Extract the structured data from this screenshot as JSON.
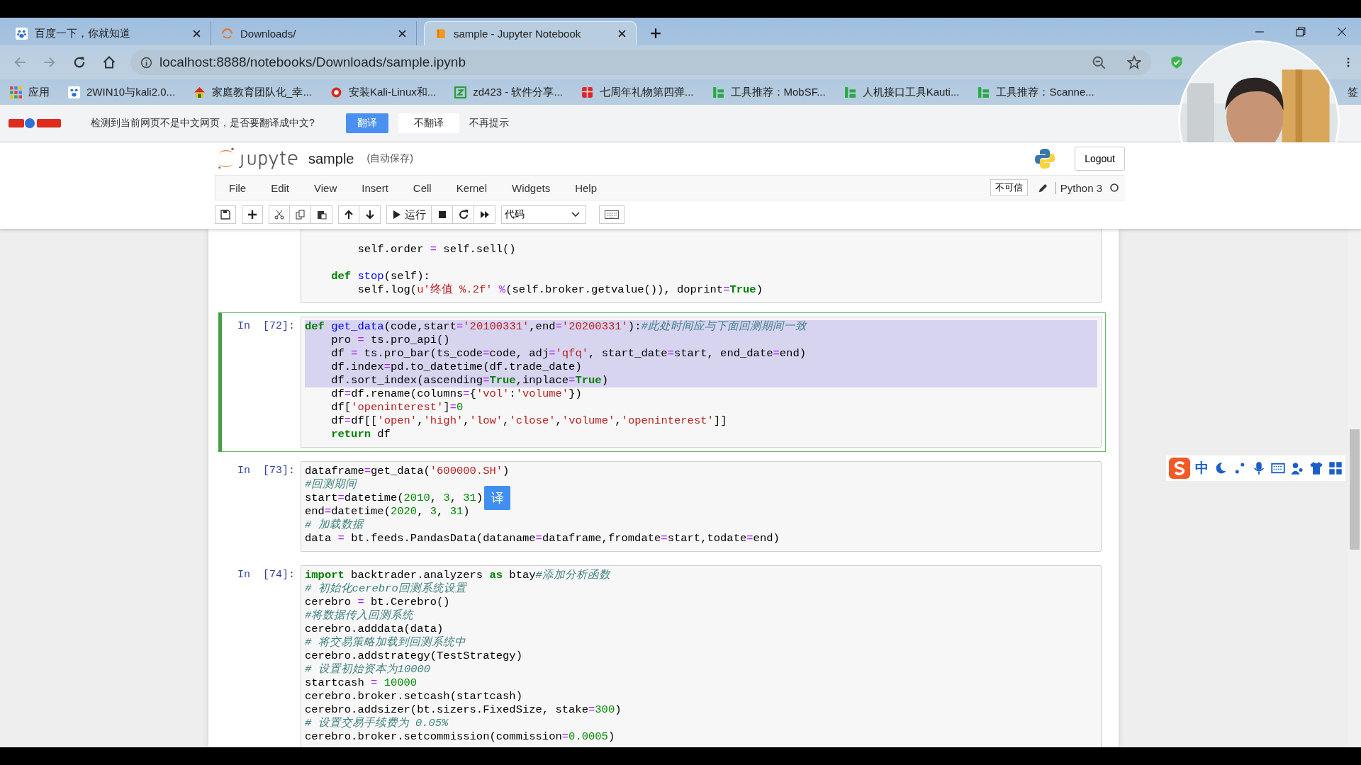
{
  "browser": {
    "tabs": [
      {
        "title": "百度一下，你就知道",
        "kind": "paw",
        "selected": false
      },
      {
        "title": "Downloads/",
        "kind": "spinner",
        "selected": false
      },
      {
        "title": "sample - Jupyter Notebook",
        "kind": "book",
        "selected": true
      }
    ],
    "address": "localhost:8888/notebooks/Downloads/sample.ipynb",
    "bookmarks": [
      {
        "label": "应用",
        "kind": "apps"
      },
      {
        "label": "2WIN10与kali2.0...",
        "kind": "paw"
      },
      {
        "label": "家庭教育团队化_幸...",
        "kind": "house"
      },
      {
        "label": "安装Kali-Linux和...",
        "kind": "red"
      },
      {
        "label": "zd423 - 软件分享...",
        "kind": "z"
      },
      {
        "label": "七周年礼物第四弹...",
        "kind": "gift"
      },
      {
        "label": "工具推荐：MobSF...",
        "kind": "bars"
      },
      {
        "label": "人机接口工具Kauti...",
        "kind": "bars"
      },
      {
        "label": "工具推荐：Scanne...",
        "kind": "bars"
      },
      {
        "label": "签",
        "kind": "folder"
      }
    ]
  },
  "translate_bar": {
    "message": "检测到当前网页不是中文网页，是否要翻译成中文?",
    "translate": "翻译",
    "dont": "不翻译",
    "never": "不再提示"
  },
  "notebook": {
    "name": "sample",
    "autosave": "(自动保存)",
    "logout": "Logout",
    "menu": [
      "File",
      "Edit",
      "View",
      "Insert",
      "Cell",
      "Kernel",
      "Widgets",
      "Help"
    ],
    "trust": "不可信",
    "kernel": "Python 3",
    "run_label": "运行",
    "cell_type": "代码",
    "cells": [
      {
        "selected": false,
        "lines": [
          {
            "highlighted": false,
            "tokens": [
              {
                "kind": "txt",
                "text": "        self.order "
              },
              {
                "kind": "op",
                "text": "="
              },
              {
                "kind": "txt",
                "text": " self.sell()"
              }
            ]
          },
          {
            "highlighted": false
          },
          {
            "highlighted": false,
            "tokens": [
              {
                "kind": "kw",
                "text": "    def "
              },
              {
                "kind": "fn",
                "text": "stop"
              },
              {
                "kind": "txt",
                "text": "(self):"
              }
            ]
          },
          {
            "highlighted": false,
            "tokens": [
              {
                "kind": "txt",
                "text": "        self.log("
              },
              {
                "kind": "str",
                "text": "u'终值 %.2f' "
              },
              {
                "kind": "op",
                "text": "%"
              },
              {
                "kind": "txt",
                "text": "(self.broker.getvalue()), doprint"
              },
              {
                "kind": "op",
                "text": "="
              },
              {
                "kind": "kw",
                "text": "True"
              },
              {
                "kind": "txt",
                "text": ")"
              }
            ]
          }
        ]
      },
      {
        "prompt": "In  [72]:",
        "selected": true,
        "lines": [
          {
            "highlighted": true,
            "tokens": [
              {
                "kind": "kw",
                "text": "def "
              },
              {
                "kind": "fn",
                "text": "get_data"
              },
              {
                "kind": "txt",
                "text": "(code,start"
              },
              {
                "kind": "op",
                "text": "="
              },
              {
                "kind": "str",
                "text": "'20100331'"
              },
              {
                "kind": "txt",
                "text": ",end"
              },
              {
                "kind": "op",
                "text": "="
              },
              {
                "kind": "str",
                "text": "'20200331'"
              },
              {
                "kind": "txt",
                "text": "):"
              },
              {
                "kind": "com",
                "text": "#此处时间应与下面回测期间一致"
              }
            ]
          },
          {
            "highlighted": true,
            "tokens": [
              {
                "kind": "txt",
                "text": "    pro "
              },
              {
                "kind": "op",
                "text": "="
              },
              {
                "kind": "txt",
                "text": " ts.pro_api()"
              }
            ]
          },
          {
            "highlighted": true,
            "tokens": [
              {
                "kind": "txt",
                "text": "    df "
              },
              {
                "kind": "op",
                "text": "="
              },
              {
                "kind": "txt",
                "text": " ts.pro_bar(ts_code"
              },
              {
                "kind": "op",
                "text": "="
              },
              {
                "kind": "txt",
                "text": "code, adj"
              },
              {
                "kind": "op",
                "text": "="
              },
              {
                "kind": "str",
                "text": "'qfq'"
              },
              {
                "kind": "txt",
                "text": ", start_date"
              },
              {
                "kind": "op",
                "text": "="
              },
              {
                "kind": "txt",
                "text": "start, end_date"
              },
              {
                "kind": "op",
                "text": "="
              },
              {
                "kind": "txt",
                "text": "end)"
              }
            ]
          },
          {
            "highlighted": true,
            "tokens": [
              {
                "kind": "txt",
                "text": "    df.index"
              },
              {
                "kind": "op",
                "text": "="
              },
              {
                "kind": "txt",
                "text": "pd.to_datetime(df.trade_date)"
              }
            ]
          },
          {
            "highlighted": true,
            "tokens": [
              {
                "kind": "txt",
                "text": "    df.sort_index(ascending"
              },
              {
                "kind": "op",
                "text": "="
              },
              {
                "kind": "kw",
                "text": "True"
              },
              {
                "kind": "txt",
                "text": ",inplace"
              },
              {
                "kind": "op",
                "text": "="
              },
              {
                "kind": "kw",
                "text": "True"
              },
              {
                "kind": "txt",
                "text": ")"
              }
            ]
          },
          {
            "highlighted": false,
            "tokens": [
              {
                "kind": "txt",
                "text": "    df"
              },
              {
                "kind": "op",
                "text": "="
              },
              {
                "kind": "txt",
                "text": "df.rename(columns"
              },
              {
                "kind": "op",
                "text": "="
              },
              {
                "kind": "txt",
                "text": "{"
              },
              {
                "kind": "str",
                "text": "'vol'"
              },
              {
                "kind": "txt",
                "text": ":"
              },
              {
                "kind": "str",
                "text": "'volume'"
              },
              {
                "kind": "txt",
                "text": "})"
              }
            ]
          },
          {
            "highlighted": false,
            "tokens": [
              {
                "kind": "txt",
                "text": "    df["
              },
              {
                "kind": "str",
                "text": "'openinterest'"
              },
              {
                "kind": "txt",
                "text": "]"
              },
              {
                "kind": "op",
                "text": "="
              },
              {
                "kind": "num",
                "text": "0"
              }
            ]
          },
          {
            "highlighted": false,
            "tokens": [
              {
                "kind": "txt",
                "text": "    df"
              },
              {
                "kind": "op",
                "text": "="
              },
              {
                "kind": "txt",
                "text": "df[["
              },
              {
                "kind": "str",
                "text": "'open'"
              },
              {
                "kind": "txt",
                "text": ","
              },
              {
                "kind": "str",
                "text": "'high'"
              },
              {
                "kind": "txt",
                "text": ","
              },
              {
                "kind": "str",
                "text": "'low'"
              },
              {
                "kind": "txt",
                "text": ","
              },
              {
                "kind": "str",
                "text": "'close'"
              },
              {
                "kind": "txt",
                "text": ","
              },
              {
                "kind": "str",
                "text": "'volume'"
              },
              {
                "kind": "txt",
                "text": ","
              },
              {
                "kind": "str",
                "text": "'openinterest'"
              },
              {
                "kind": "txt",
                "text": "]]"
              }
            ]
          },
          {
            "highlighted": false,
            "tokens": [
              {
                "kind": "kw",
                "text": "    return"
              },
              {
                "kind": "txt",
                "text": " df"
              }
            ]
          }
        ]
      },
      {
        "prompt": "In  [73]:",
        "selected": false,
        "lines": [
          {
            "highlighted": false,
            "tokens": [
              {
                "kind": "txt",
                "text": "dataframe"
              },
              {
                "kind": "op",
                "text": "="
              },
              {
                "kind": "txt",
                "text": "get_data("
              },
              {
                "kind": "str",
                "text": "'600000.SH'"
              },
              {
                "kind": "txt",
                "text": ")"
              }
            ]
          },
          {
            "highlighted": false,
            "tokens": [
              {
                "kind": "com",
                "text": "#回测期间"
              }
            ]
          },
          {
            "highlighted": false,
            "popup": "译",
            "tokens": [
              {
                "kind": "txt",
                "text": "start"
              },
              {
                "kind": "op",
                "text": "="
              },
              {
                "kind": "txt",
                "text": "datetime("
              },
              {
                "kind": "num",
                "text": "2010"
              },
              {
                "kind": "txt",
                "text": ", "
              },
              {
                "kind": "num",
                "text": "3"
              },
              {
                "kind": "txt",
                "text": ", "
              },
              {
                "kind": "num",
                "text": "31"
              },
              {
                "kind": "txt",
                "text": ")"
              }
            ]
          },
          {
            "highlighted": false,
            "tokens": [
              {
                "kind": "txt",
                "text": "end"
              },
              {
                "kind": "op",
                "text": "="
              },
              {
                "kind": "txt",
                "text": "datetime("
              },
              {
                "kind": "num",
                "text": "2020"
              },
              {
                "kind": "txt",
                "text": ", "
              },
              {
                "kind": "num",
                "text": "3"
              },
              {
                "kind": "txt",
                "text": ", "
              },
              {
                "kind": "num",
                "text": "31"
              },
              {
                "kind": "txt",
                "text": ")"
              }
            ]
          },
          {
            "highlighted": false,
            "tokens": [
              {
                "kind": "com",
                "text": "# 加载数据"
              }
            ]
          },
          {
            "highlighted": false,
            "tokens": [
              {
                "kind": "txt",
                "text": "data "
              },
              {
                "kind": "op",
                "text": "="
              },
              {
                "kind": "txt",
                "text": " bt.feeds.PandasData(dataname"
              },
              {
                "kind": "op",
                "text": "="
              },
              {
                "kind": "txt",
                "text": "dataframe,fromdate"
              },
              {
                "kind": "op",
                "text": "="
              },
              {
                "kind": "txt",
                "text": "start,todate"
              },
              {
                "kind": "op",
                "text": "="
              },
              {
                "kind": "txt",
                "text": "end)"
              }
            ]
          }
        ]
      },
      {
        "prompt": "In  [74]:",
        "selected": false,
        "lines": [
          {
            "highlighted": false,
            "tokens": [
              {
                "kind": "kw",
                "text": "import"
              },
              {
                "kind": "txt",
                "text": " backtrader.analyzers "
              },
              {
                "kind": "kw",
                "text": "as"
              },
              {
                "kind": "txt",
                "text": " btay"
              },
              {
                "kind": "com",
                "text": "#添加分析函数"
              }
            ]
          },
          {
            "highlighted": false,
            "tokens": [
              {
                "kind": "com",
                "text": "# 初始化cerebro回测系统设置"
              }
            ]
          },
          {
            "highlighted": false,
            "tokens": [
              {
                "kind": "txt",
                "text": "cerebro "
              },
              {
                "kind": "op",
                "text": "="
              },
              {
                "kind": "txt",
                "text": " bt.Cerebro()"
              }
            ]
          },
          {
            "highlighted": false,
            "tokens": [
              {
                "kind": "com",
                "text": "#将数据传入回测系统"
              }
            ]
          },
          {
            "highlighted": false,
            "tokens": [
              {
                "kind": "txt",
                "text": "cerebro.adddata(data)"
              }
            ]
          },
          {
            "highlighted": false,
            "tokens": [
              {
                "kind": "com",
                "text": "# 将交易策略加载到回测系统中"
              }
            ]
          },
          {
            "highlighted": false,
            "tokens": [
              {
                "kind": "txt",
                "text": "cerebro.addstrategy(TestStrategy)"
              }
            ]
          },
          {
            "highlighted": false,
            "tokens": [
              {
                "kind": "com",
                "text": "# 设置初始资本为10000"
              }
            ]
          },
          {
            "highlighted": false,
            "tokens": [
              {
                "kind": "txt",
                "text": "startcash "
              },
              {
                "kind": "op",
                "text": "="
              },
              {
                "kind": "num",
                "text": " 10000"
              }
            ]
          },
          {
            "highlighted": false,
            "tokens": [
              {
                "kind": "txt",
                "text": "cerebro.broker.setcash(startcash)"
              }
            ]
          },
          {
            "highlighted": false,
            "tokens": [
              {
                "kind": "txt",
                "text": "cerebro.addsizer(bt.sizers.FixedSize, stake"
              },
              {
                "kind": "op",
                "text": "="
              },
              {
                "kind": "num",
                "text": "300"
              },
              {
                "kind": "txt",
                "text": ")"
              }
            ]
          },
          {
            "highlighted": false,
            "tokens": [
              {
                "kind": "com",
                "text": "# 设置交易手续费为 0.05%"
              }
            ]
          },
          {
            "highlighted": false,
            "tokens": [
              {
                "kind": "txt",
                "text": "cerebro.broker.setcommission(commission"
              },
              {
                "kind": "op",
                "text": "="
              },
              {
                "kind": "num",
                "text": "0.0005"
              },
              {
                "kind": "txt",
                "text": ")"
              }
            ]
          }
        ]
      }
    ]
  },
  "ime": {
    "label": "中"
  }
}
